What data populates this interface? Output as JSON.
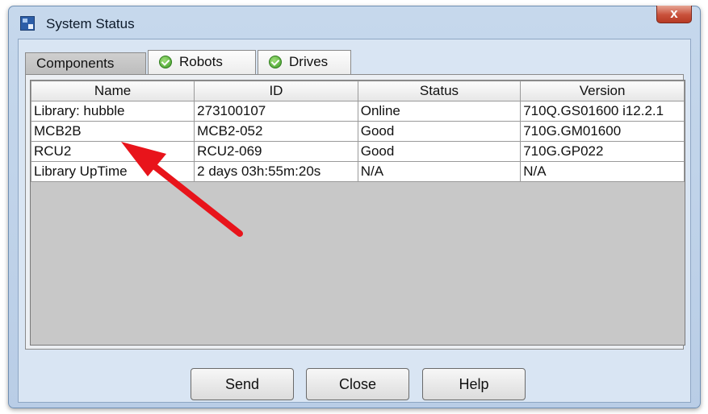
{
  "window": {
    "title": "System Status",
    "close_glyph": "x"
  },
  "tabs": [
    {
      "label": "Components",
      "active": true,
      "icon": ""
    },
    {
      "label": "Robots",
      "active": false,
      "icon": "check-circle-icon"
    },
    {
      "label": "Drives",
      "active": false,
      "icon": "check-circle-icon"
    }
  ],
  "table": {
    "columns": [
      "Name",
      "ID",
      "Status",
      "Version"
    ],
    "rows": [
      [
        "Library: hubble",
        "273100107",
        "Online",
        "710Q.GS01600 i12.2.1"
      ],
      [
        "MCB2B",
        "MCB2-052",
        "Good",
        "710G.GM01600"
      ],
      [
        "RCU2",
        "RCU2-069",
        "Good",
        "710G.GP022"
      ],
      [
        "Library UpTime",
        "2 days 03h:55m:20s",
        "N/A",
        "N/A"
      ]
    ]
  },
  "buttons": {
    "send": "Send",
    "close": "Close",
    "help": "Help"
  },
  "colors": {
    "annotation_arrow": "#e8141b",
    "status_ok": "#3d9a26"
  }
}
